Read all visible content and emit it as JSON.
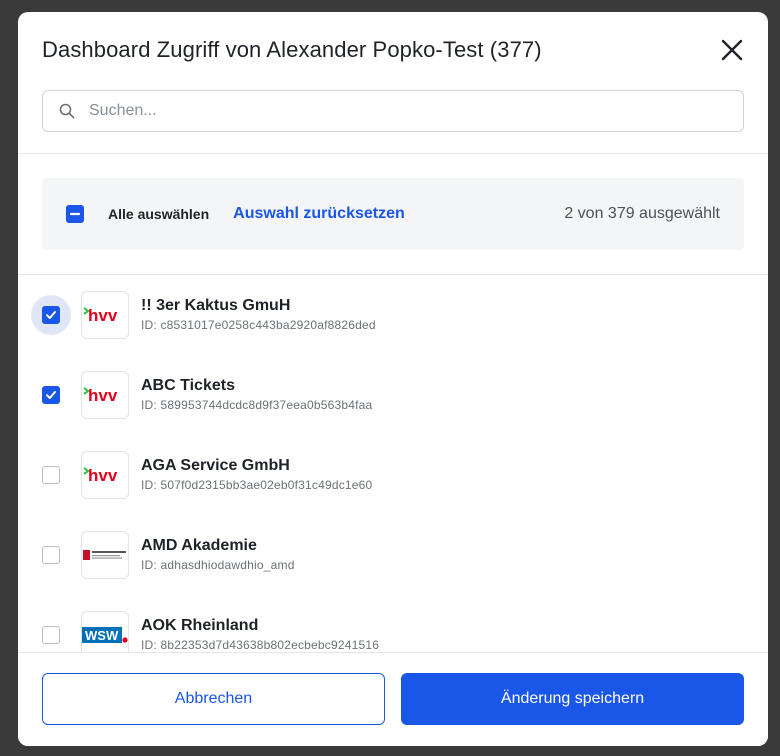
{
  "modal": {
    "title": "Dashboard Zugriff von Alexander Popko-Test (377)"
  },
  "search": {
    "placeholder": "Suchen..."
  },
  "selection": {
    "select_all_label": "Alle auswählen",
    "reset_label": "Auswahl zurücksetzen",
    "count_text": "2 von 379 ausgewählt",
    "select_all_state": "indeterminate"
  },
  "items": [
    {
      "name": "!! 3er Kaktus GmuH",
      "id": "ID: c8531017e0258c443ba2920af8826ded",
      "checked": true,
      "logo": "hvv-logo"
    },
    {
      "name": "ABC Tickets",
      "id": "ID: 589953744dcdc8d9f37eea0b563b4faa",
      "checked": true,
      "logo": "hvv-logo"
    },
    {
      "name": "AGA Service GmbH",
      "id": "ID: 507f0d2315bb3ae02eb0f31c49dc1e60",
      "checked": false,
      "logo": "hvv-logo"
    },
    {
      "name": "AMD Akademie",
      "id": "ID: adhasdhiodawdhio_amd",
      "checked": false,
      "logo": "amd-akademie-logo"
    },
    {
      "name": "AOK Rheinland",
      "id": "ID: 8b22353d7d43638b802ecbebc9241516",
      "checked": false,
      "logo": "wsw-logo"
    }
  ],
  "logos": {
    "hvv_text": "hvv",
    "wsw_text": "WSW"
  },
  "footer": {
    "cancel_label": "Abbrechen",
    "save_label": "Änderung speichern"
  },
  "colors": {
    "accent": "#1a56e8",
    "hvv_red": "#e2001a",
    "hvv_green": "#2bbf3a",
    "wsw_blue": "#0071b9"
  }
}
